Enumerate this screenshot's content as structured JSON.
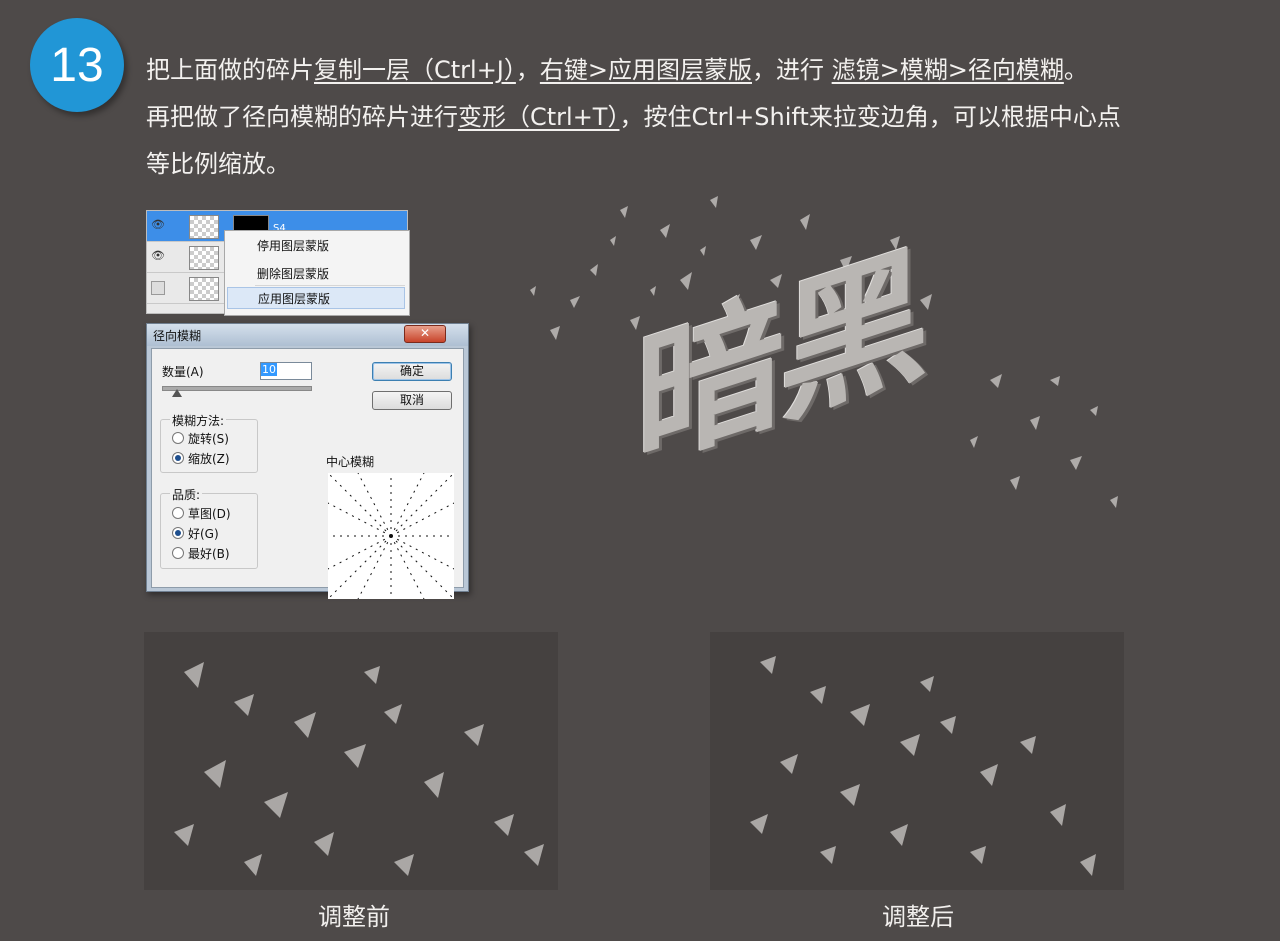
{
  "step": {
    "number": "13"
  },
  "instructions": {
    "line1": {
      "p1": "把上面做的碎片",
      "link1": "复制一层（Ctrl+J）",
      "p2": "，",
      "link2": "右键>应用图层蒙版",
      "p3": "，进行 ",
      "link3": "滤镜>模糊>径向模糊",
      "p4": "。"
    },
    "line2": {
      "p1": "再把做了径向模糊的碎片进行",
      "link1": "变形（Ctrl+T）",
      "p2": "，按住Ctrl+Shift来拉变边角，可以根据中心点"
    },
    "line3": "等比例缩放。"
  },
  "layers_panel": {
    "layer_name": "S4",
    "context_menu": {
      "items": [
        "停用图层蒙版",
        "删除图层蒙版",
        "应用图层蒙版"
      ],
      "highlighted_index": 2
    }
  },
  "radial_blur_dialog": {
    "title": "径向模糊",
    "close_label": "✕",
    "amount_label": "数量(A)",
    "amount_value": "10",
    "ok_label": "确定",
    "cancel_label": "取消",
    "method_label": "模糊方法:",
    "method_options": [
      "旋转(S)",
      "缩放(Z)"
    ],
    "method_selected": 1,
    "quality_label": "品质:",
    "quality_options": [
      "草图(D)",
      "好(G)",
      "最好(B)"
    ],
    "quality_selected": 1,
    "center_label": "中心模糊"
  },
  "preview_text": "暗黑",
  "captions": {
    "before": "调整前",
    "after": "调整后"
  },
  "colors": {
    "background": "#4e4a49",
    "badge": "#2196d6",
    "text": "#f3f1ef"
  }
}
